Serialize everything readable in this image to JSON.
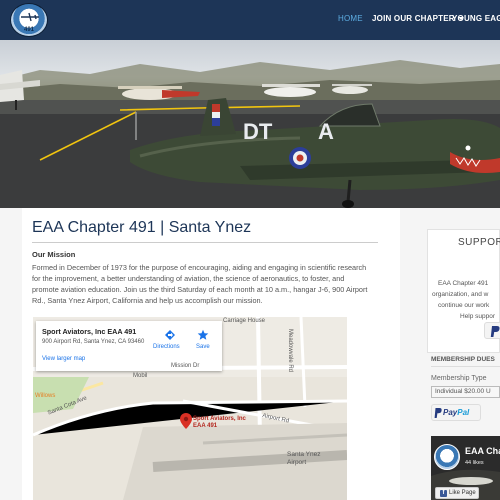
{
  "navbar": {
    "logo_number": "491",
    "items": [
      {
        "label": "HOME",
        "active": true
      },
      {
        "label": "JOIN OUR CHAPTER",
        "active": false
      },
      {
        "label": "YOUNG EAGLES",
        "active": false
      }
    ]
  },
  "hero": {
    "aircraft_code_left": "DT",
    "aircraft_code_right": "A"
  },
  "main": {
    "title": "EAA Chapter 491 | Santa Ynez",
    "mission_heading": "Our Mission",
    "mission_lines": [
      "Formed in December of 1973 for the purpose of encouraging, aiding and engaging in scientific research",
      "for the improvement, a better understanding of aviation, the science of aeronautics, to foster, and",
      "promote aviation education. Join us the third Saturday of each month at 10 a.m., hangar J-6, 900 Airport",
      "Rd., Santa Ynez Airport, California and help us accomplish our mission."
    ]
  },
  "map": {
    "card_title": "Sport Aviators, Inc EAA 491",
    "card_address": "900 Airport Rd, Santa Ynez, CA 93460",
    "larger_map_link": "View larger map",
    "directions_label": "Directions",
    "save_label": "Save",
    "labels": {
      "carriage_house": "Carriage House",
      "meadowvale": "Meadowvale Rd",
      "mission": "Mission Dr",
      "mobil": "Mobil",
      "willows": "Willows",
      "santa_cota": "Santa Cota Ave",
      "airport_rd": "Airport Rd",
      "airport": "Santa Ynez\nAirport"
    },
    "pin_label": "Sport Aviators, Inc EAA 491"
  },
  "sidebar": {
    "support_title": "SUPPORT",
    "support_lines": [
      "EAA Chapter 491",
      "organization, and w",
      "continue our work",
      "Help suppor"
    ],
    "membership_heading": "MEMBERSHIP DUES",
    "membership_type_label": "Membership Type",
    "membership_type_value": "Individual $20.00 U",
    "paypal_pay": "Pay",
    "paypal_pal": "Pal",
    "facebook": {
      "name": "EAA Chap",
      "likes": "44 likes",
      "like_button": "Like Page"
    }
  }
}
